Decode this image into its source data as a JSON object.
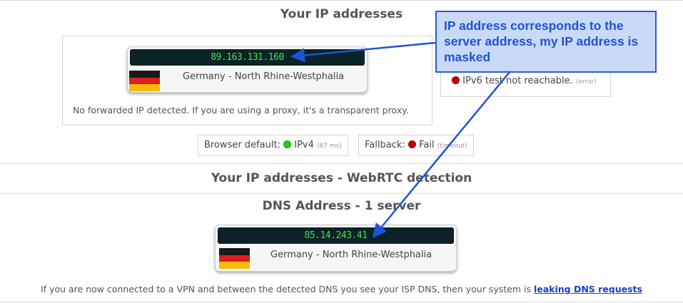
{
  "ip_section": {
    "title": "Your IP addresses",
    "ip_value": "89.163.131.160",
    "location": "Germany - North Rhine-Westphalia",
    "forward_note": "No forwarded IP detected. If you are using a proxy, it's a transparent proxy."
  },
  "ipv6": {
    "status_text": "IPv6 test not reachable.",
    "status_tag": "(error)",
    "status_color": "#c30000"
  },
  "browser": {
    "default_label": "Browser default:",
    "default_value": "IPv4",
    "default_ms": "(87 ms)",
    "default_color": "#20d020",
    "fallback_label": "Fallback:",
    "fallback_value": "Fail",
    "fallback_tag": "(timeout)",
    "fallback_color": "#c30000"
  },
  "webrtc": {
    "title": "Your IP addresses - WebRTC detection"
  },
  "dns": {
    "title": "DNS Address - 1 server",
    "ip_value": "85.14.243.41",
    "location": "Germany - North Rhine-Westphalia"
  },
  "footer": {
    "text": "If you are now connected to a VPN and between the detected DNS you see your ISP DNS, then your system is",
    "link": "leaking DNS requests"
  },
  "annotation": {
    "text": "IP address corresponds to the server address, my IP address is masked",
    "color": "#1f53d8"
  },
  "flags": {
    "country": "germany-flag-icon"
  }
}
